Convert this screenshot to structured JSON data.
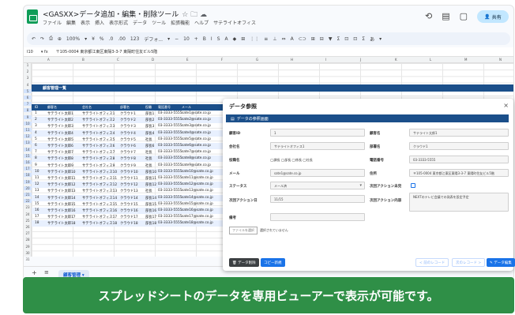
{
  "app": {
    "doc_title": "<GASXX>データ追加・編集・削除ツール",
    "title_icons": "☆ 🗀 ☁",
    "menus": [
      "ファイル",
      "編集",
      "表示",
      "挿入",
      "表示形式",
      "データ",
      "ツール",
      "拡張機能",
      "ヘルプ",
      "サテライトオフィス"
    ],
    "share_label": "共有"
  },
  "toolbar": {
    "items": [
      "↶",
      "↷",
      "⎙",
      "⊕",
      "100%",
      "▾",
      "¥",
      "%",
      ".0",
      ".00",
      "123",
      "デフォ...",
      "▾",
      "−",
      "10",
      "+",
      "B",
      "I",
      "S",
      "A",
      "◆",
      "⊞",
      "⋮⋮",
      "≡",
      "⊥",
      "⇔",
      "A",
      "⊂⊃",
      "⊞",
      "⊟",
      "▼",
      "Σ",
      "⊡",
      "⊡",
      "Σ",
      "あ",
      "▾"
    ]
  },
  "formula": {
    "cell_ref": "I10",
    "fx_value": "〒105-0004 東京都江東区東陽3-3-7 東陽町住友ビル5階"
  },
  "columns": [
    "A",
    "B",
    "C",
    "D",
    "E",
    "F",
    "G",
    "H",
    "I",
    "J",
    "K",
    "L",
    "M",
    "N"
  ],
  "rows": [
    "1",
    "2",
    "3",
    "4",
    "5",
    "6",
    "7",
    "8",
    "9",
    "10",
    "11",
    "12",
    "13",
    "14",
    "15",
    "16",
    "17",
    "18",
    "19",
    "20",
    "21",
    "22",
    "23",
    "24",
    "25",
    "26",
    "27",
    "28",
    "29",
    "30",
    "31"
  ],
  "sheet": {
    "banner_title": "顧客管理一覧",
    "headers": [
      "ID",
      "顧客名",
      "会社名",
      "部署名",
      "役職",
      "電話番号",
      "メール"
    ],
    "records": [
      [
        "1",
        "サテライト太郎1",
        "サテライトオフィス1",
        "クラウド1",
        "部長1",
        "03-3333-5555",
        "sate1@sate.co.jp"
      ],
      [
        "2",
        "サテライト太郎2",
        "サテライトオフィス2",
        "クラウド2",
        "部長2",
        "03-3333-5555",
        "sate2@sate.co.jp"
      ],
      [
        "3",
        "サテライト太郎3",
        "サテライトオフィス3",
        "クラウド3",
        "部長3",
        "03-3333-5555",
        "sate3@sate.co.jp"
      ],
      [
        "4",
        "サテライト太郎4",
        "サテライトオフィス4",
        "クラウド4",
        "部長4",
        "03-3333-5555",
        "sate4@sate.co.jp"
      ],
      [
        "5",
        "サテライト太郎5",
        "サテライトオフィス5",
        "クラウド5",
        "社長",
        "03-3333-5555",
        "sate5@sate.co.jp"
      ],
      [
        "6",
        "サテライト太郎6",
        "サテライトオフィス6",
        "クラウド6",
        "部長6",
        "03-3333-5555",
        "sate6@sate.co.jp"
      ],
      [
        "7",
        "サテライト太郎7",
        "サテライトオフィス7",
        "クラウド7",
        "社長",
        "03-3333-5555",
        "sate7@sate.co.jp"
      ],
      [
        "8",
        "サテライト太郎8",
        "サテライトオフィス8",
        "クラウド8",
        "社長",
        "03-3333-5555",
        "sate8@sate.co.jp"
      ],
      [
        "9",
        "サテライト太郎9",
        "サテライトオフィス9",
        "クラウド9",
        "社長",
        "03-3333-5555",
        "sate9@sate.co.jp"
      ],
      [
        "10",
        "サテライト太郎10",
        "サテライトオフィス10",
        "クラウド10",
        "部長10",
        "03-3333-5555",
        "sate10@sate.co.jp"
      ],
      [
        "11",
        "サテライト太郎11",
        "サテライトオフィス11",
        "クラウド11",
        "部長11",
        "03-3333-5555",
        "sate11@sate.co.jp"
      ],
      [
        "12",
        "サテライト太郎12",
        "サテライトオフィス12",
        "クラウド12",
        "部長12",
        "03-3333-5555",
        "sate12@sate.co.jp"
      ],
      [
        "13",
        "サテライト太郎13",
        "サテライトオフィス13",
        "クラウド13",
        "社長",
        "03-3333-5555",
        "sate13@sate.co.jp"
      ],
      [
        "14",
        "サテライト太郎14",
        "サテライトオフィス14",
        "クラウド14",
        "部長14",
        "03-3333-5555",
        "sate14@sate.co.jp"
      ],
      [
        "15",
        "サテライト太郎15",
        "サテライトオフィス15",
        "クラウド15",
        "部長15",
        "03-3333-5555",
        "sate15@sate.co.jp"
      ],
      [
        "16",
        "サテライト太郎16",
        "サテライトオフィス16",
        "クラウド16",
        "部長16",
        "03-3333-5555",
        "sate16@sate.co.jp"
      ],
      [
        "17",
        "サテライト太郎17",
        "サテライトオフィス17",
        "クラウド17",
        "部長17",
        "03-3333-5555",
        "sate17@sate.co.jp"
      ],
      [
        "18",
        "サテライト太郎18",
        "サテライトオフィス18",
        "クラウド18",
        "部長18",
        "03-3333-5555",
        "sate18@sate.co.jp"
      ]
    ]
  },
  "sheet_tab": {
    "plus": "+",
    "list": "≡",
    "name": "顧客管理 ▾"
  },
  "dialog": {
    "title": "データ参照",
    "close": "×",
    "subheader": "データの参照画面",
    "fields": {
      "id_label": "顧客ID",
      "id_value": "1",
      "name_label": "顧客名",
      "name_value": "サテライト太郎1",
      "company_label": "会社名",
      "company_value": "サテライトオフィス1",
      "dept_label": "部署名",
      "dept_value": "クラウド1",
      "position_label": "役職名",
      "position_value": "◯課長 ◯部長 ◯係長 ◯社長",
      "phone_label": "電話番号",
      "phone_value": "03-3333-5555",
      "email_label": "メール",
      "email_value": "sate1@sate.co.jp",
      "address_label": "住所",
      "address_value": "〒105-0004 東京都江東区東陽3-3-7 東陽町住友ビル5階",
      "status_label": "ステータス",
      "status_value": "メール済",
      "next_flag_label": "次回アクション未完",
      "next_date_label": "次回アクション日",
      "next_date_value": "11/15",
      "next_detail_label": "次回アクション内容",
      "next_detail_value": "NEXTのテレビ会議での発表を設定予定",
      "remarks_label": "備考",
      "remarks_value": ""
    },
    "attach_button": "ファイルを選択",
    "attach_text": "選択されていません",
    "buttons": {
      "delete": "🗑 データ削除",
      "copy": "コピー新規",
      "prev": "< 前のレコード",
      "next": "次のレコード >",
      "edit": "✎ データ編集"
    }
  },
  "caption": "スプレッドシートのデータを専用ビューアーで表示が可能です。"
}
